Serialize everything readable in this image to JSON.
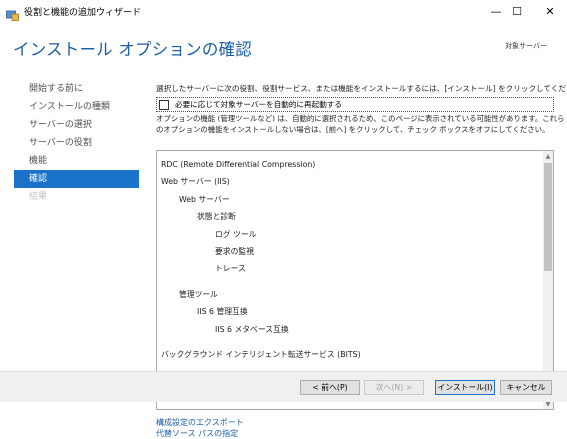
{
  "window": {
    "title": "役割と機能の追加ウィザード",
    "controls": {
      "minimize": "—",
      "maximize": "☐",
      "close": "✕"
    }
  },
  "header": {
    "page_title": "インストール オプションの確認",
    "target_server": "対象サーバー"
  },
  "sidebar": {
    "items": [
      {
        "label": "開始する前に",
        "state": "normal"
      },
      {
        "label": "インストールの種類",
        "state": "normal"
      },
      {
        "label": "サーバーの選択",
        "state": "normal"
      },
      {
        "label": "サーバーの役割",
        "state": "normal"
      },
      {
        "label": "機能",
        "state": "normal"
      },
      {
        "label": "確認",
        "state": "active"
      },
      {
        "label": "結果",
        "state": "disabled"
      }
    ]
  },
  "main": {
    "description": "選択したサーバーに次の役割、役割サービス、または機能をインストールするには、[インストール] をクリックしてください。",
    "restart_checkbox": {
      "label": "必要に応じて対象サーバーを自動的に再起動する",
      "checked": false
    },
    "note_line1": "オプションの機能 (管理ツールなど) は、自動的に選択されるため、このページに表示されている可能性があります。これら",
    "note_line2": "のオプションの機能をインストールしない場合は、[前へ] をクリックして、チェック ボックスをオフにしてください。",
    "features": [
      {
        "label": "RDC (Remote Differential Compression)",
        "level": 0
      },
      {
        "label": "Web サーバー (IIS)",
        "level": 0
      },
      {
        "label": "Web サーバー",
        "level": 1
      },
      {
        "label": "状態と診断",
        "level": 2
      },
      {
        "label": "ログ ツール",
        "level": 3
      },
      {
        "label": "要求の監視",
        "level": 3
      },
      {
        "label": "トレース",
        "level": 3
      },
      {
        "label": "管理ツール",
        "level": 1,
        "gap_before": true
      },
      {
        "label": "IIS 6 管理互換",
        "level": 2
      },
      {
        "label": "IIS 6 メタベース互換",
        "level": 3
      },
      {
        "label": "バックグラウンド インテリジェント転送サービス (BITS)",
        "level": 0,
        "gap_before": true
      }
    ],
    "links": {
      "export": "構成設定のエクスポート",
      "alt_source": "代替ソース パスの指定"
    }
  },
  "footer": {
    "prev": "< 前へ(P)",
    "next": "次へ(N) >",
    "install": "インストール(I)",
    "cancel": "キャンセル"
  },
  "colors": {
    "accent": "#1a73c9",
    "title": "#1c5fa8",
    "link": "#1a5dab"
  }
}
